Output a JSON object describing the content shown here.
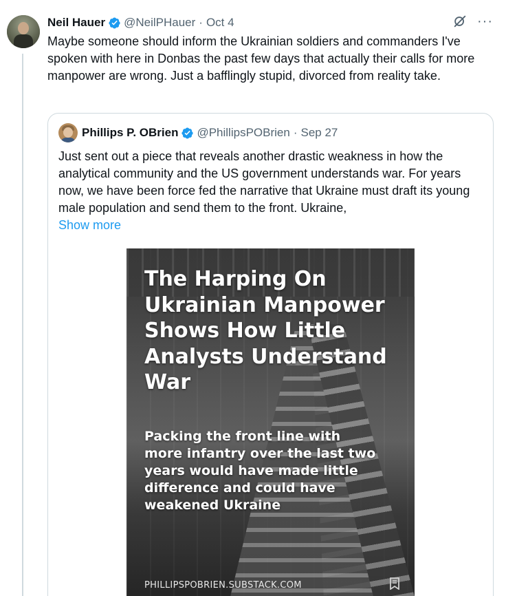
{
  "tweet": {
    "author_name": "Neil Hauer",
    "handle": "@NeilPHauer",
    "separator": "·",
    "date": "Oct 4",
    "more_label": "···",
    "text": "Maybe someone should inform the Ukrainian soldiers and commanders I've spoken with here in Donbas the past few days that actually their calls for more manpower are wrong. Just a bafflingly stupid, divorced from reality take."
  },
  "quote": {
    "author_name": "Phillips P. OBrien",
    "handle": "@PhillipsPOBrien",
    "separator": "·",
    "date": "Sep 27",
    "text": "Just sent out a piece that reveals another drastic weakness in how the analytical community and the US government understands war. For years now, we have been force fed the narrative that Ukraine must draft its young male population and send them to the front. Ukraine,",
    "show_more": "Show more",
    "image": {
      "title": "The Harping On Ukrainian Manpower Shows How Little Analysts Understand War",
      "subtitle": "Packing the front line with more infantry over the last two years would have made little difference and could have weakened Ukraine",
      "domain": "PHILLIPSPOBRIEN.SUBSTACK.COM"
    }
  },
  "colors": {
    "verified_blue": "#1d9bf0",
    "link_blue": "#1d9bf0",
    "secondary_text": "#536471",
    "border": "#cfd9de"
  }
}
